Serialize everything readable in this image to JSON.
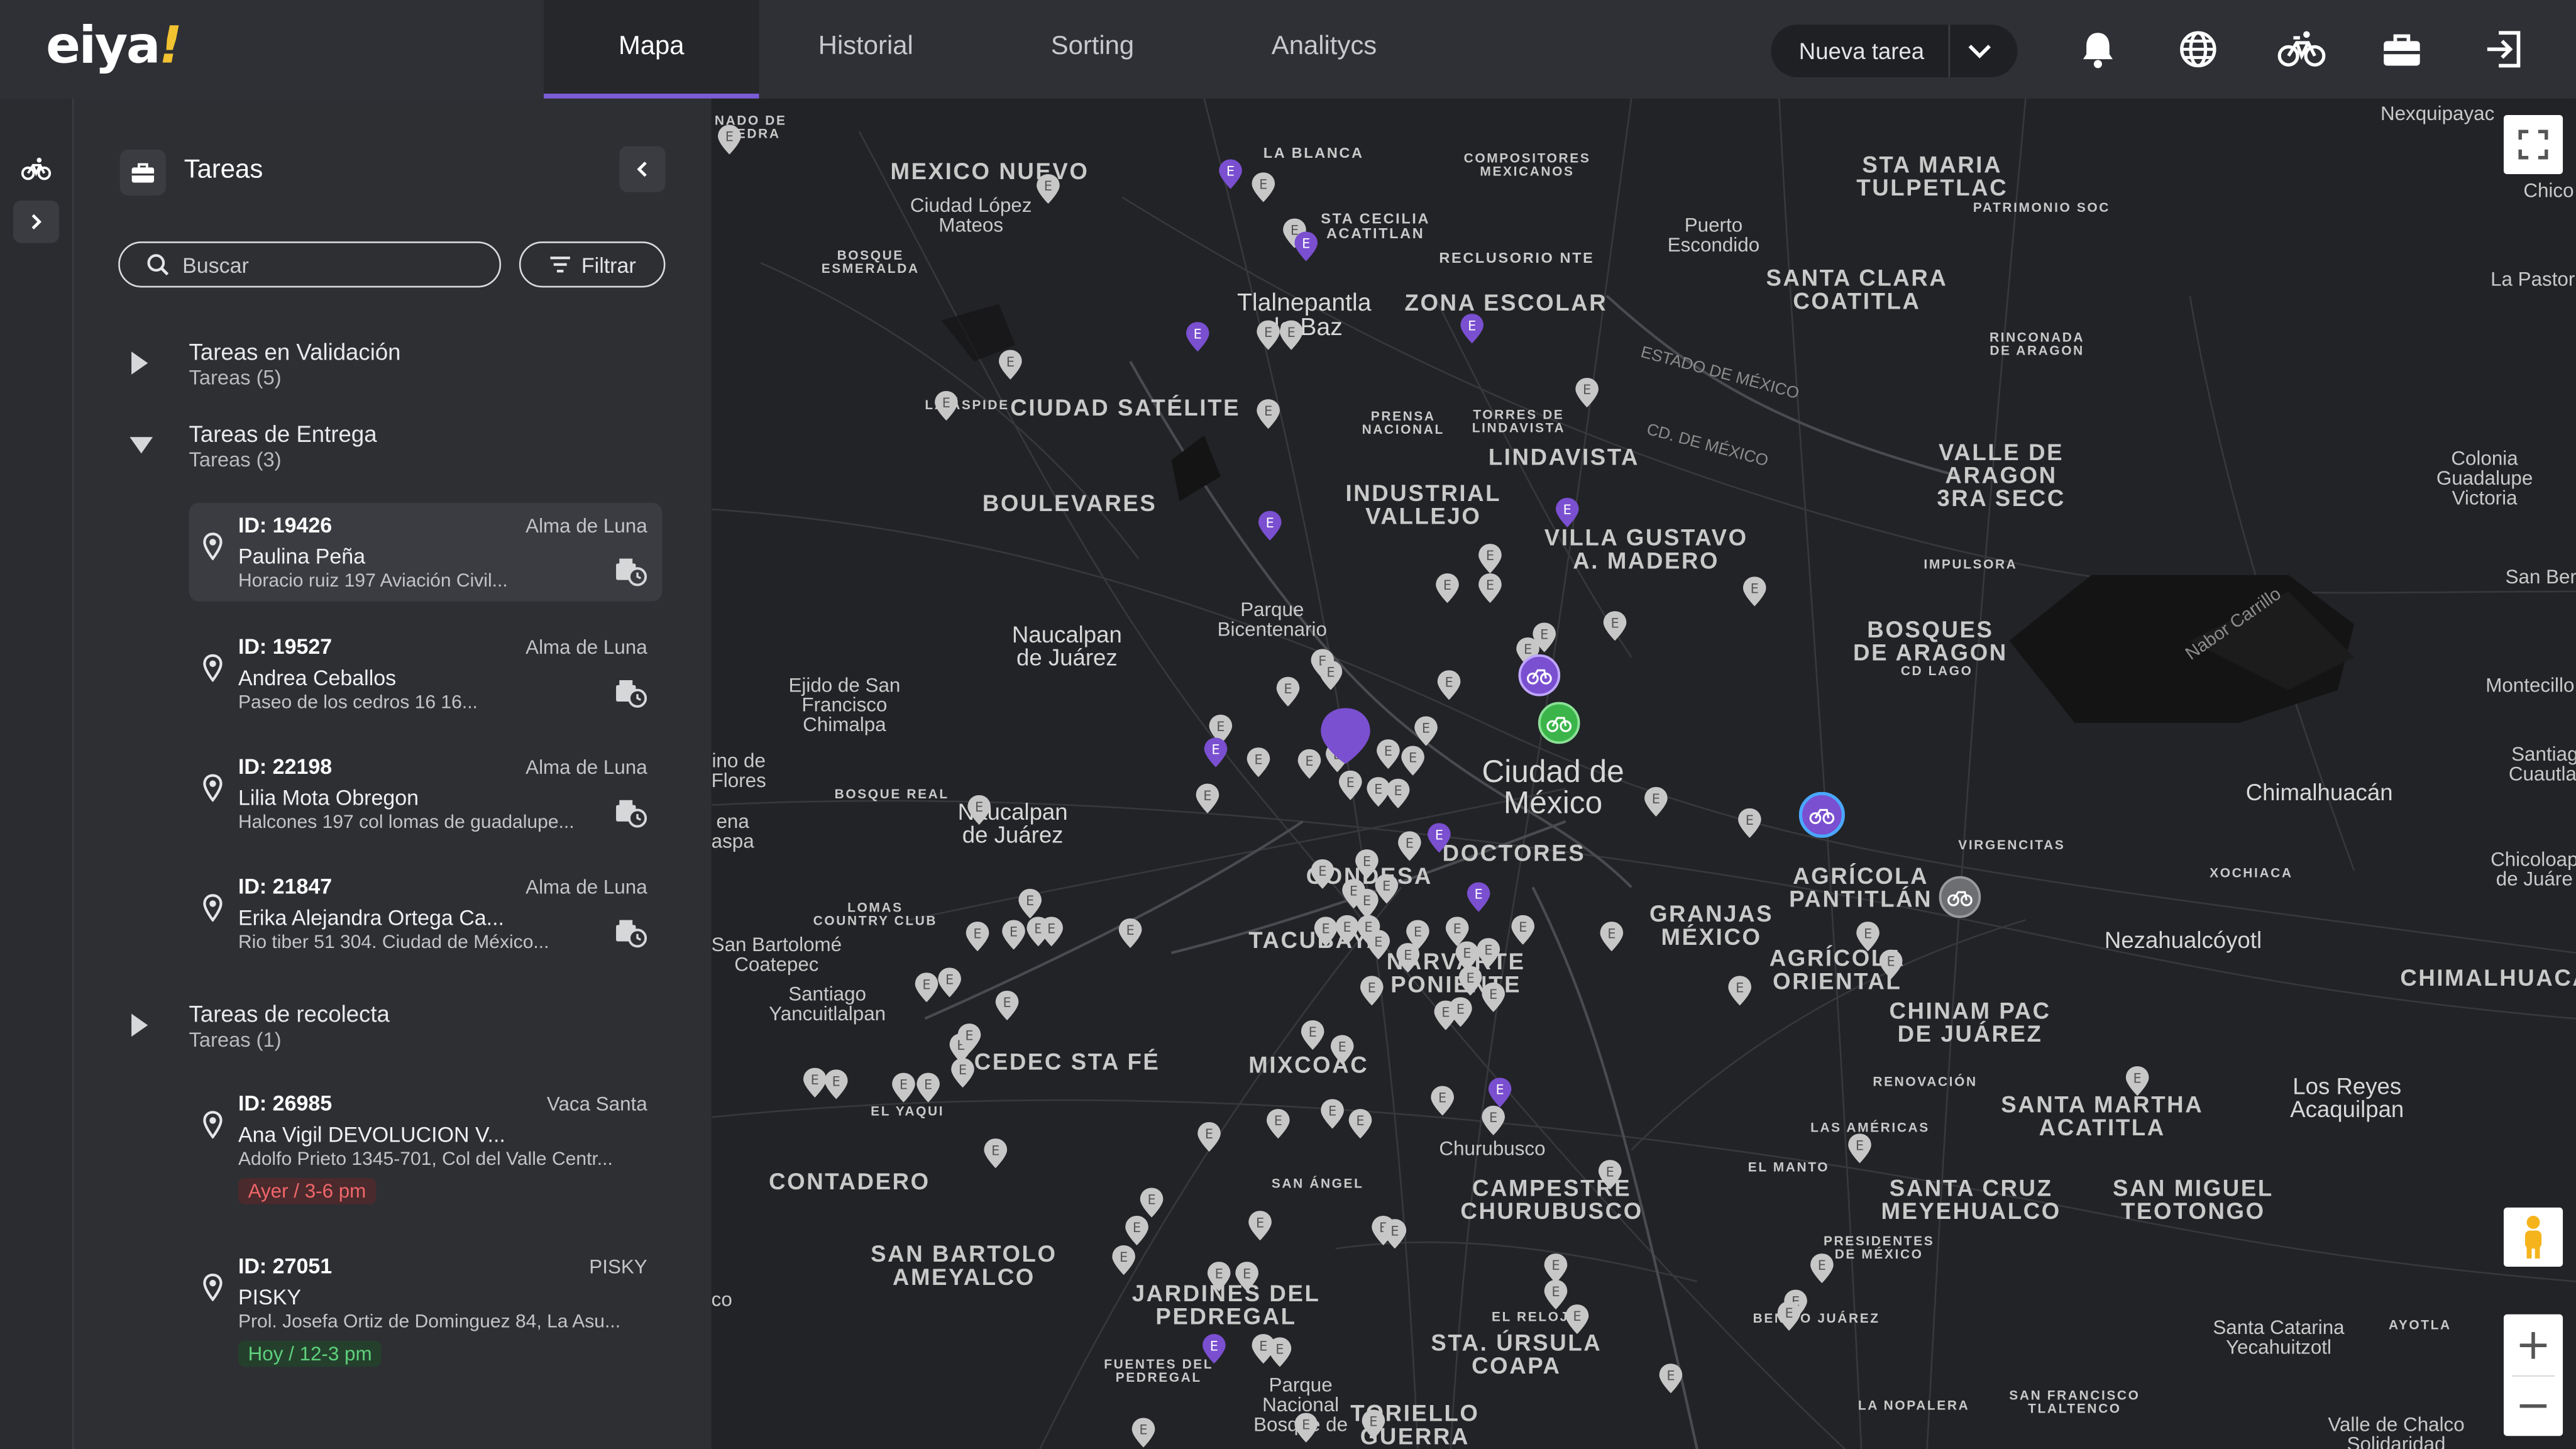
{
  "brand": {
    "logo_text": "eiya",
    "logo_accent": "!",
    "accent_color": "#f2c230",
    "tab_indicator_color": "#7b5cd6"
  },
  "nav": {
    "tabs": [
      {
        "label": "Mapa",
        "active": true
      },
      {
        "label": "Historial",
        "active": false
      },
      {
        "label": "Sorting",
        "active": false
      },
      {
        "label": "Analitycs",
        "active": false
      }
    ],
    "new_task_label": "Nueva tarea",
    "icons": [
      "bell-icon",
      "globe-icon",
      "bicycle-icon",
      "briefcase-icon",
      "logout-icon"
    ]
  },
  "panel": {
    "title": "Tareas",
    "search_placeholder": "Buscar",
    "filter_label": "Filtrar",
    "groups": [
      {
        "name": "Tareas en Validación",
        "count_label": "Tareas (5)",
        "expanded": false
      },
      {
        "name": "Tareas de Entrega",
        "count_label": "Tareas (3)",
        "expanded": true,
        "tasks": [
          {
            "id": "ID: 19426",
            "store": "Alma de Luna",
            "name": "Paulina Peña",
            "address": "Horacio ruiz 197 Aviación Civil...",
            "selected": true
          },
          {
            "id": "ID: 19527",
            "store": "Alma de Luna",
            "name": "Andrea Ceballos",
            "address": "Paseo de los cedros 16 16..."
          },
          {
            "id": "ID: 22198",
            "store": "Alma de Luna",
            "name": "Lilia Mota Obregon",
            "address": "Halcones 197 col lomas de guadalupe..."
          },
          {
            "id": "ID: 21847",
            "store": "Alma de Luna",
            "name": "Erika Alejandra Ortega Ca...",
            "address": "Rio tiber 51 304. Ciudad de México..."
          }
        ]
      },
      {
        "name": "Tareas de recolecta",
        "count_label": "Tareas (1)",
        "expanded": false,
        "tasks": [
          {
            "id": "ID: 26985",
            "store": "Vaca Santa",
            "name": "Ana Vigil DEVOLUCION V...",
            "address": "Adolfo Prieto 1345-701, Col del Valle Centr...",
            "badge": "Ayer / 3-6 pm",
            "badge_color": "#f0666a"
          },
          {
            "id": "ID: 27051",
            "store": "PISKY",
            "name": "PISKY",
            "address": "Prol. Josefa Ortiz de Dominguez 84, La Asu...",
            "badge": "Hoy / 12-3 pm",
            "badge_color": "#5fd07c"
          }
        ]
      }
    ]
  },
  "map": {
    "labels": {
      "mexico_nuevo": "MEXICO NUEVO",
      "ciudad_lopez_mateos": "Ciudad López\nMateos",
      "tlalnepantla": "Tlalnepantla\nde Baz",
      "zona_escolar": "ZONA ESCOLAR",
      "santa_clara": "SANTA CLARA\nCOATITLA",
      "sta_maria_tulpetlac": "STA MARIA\nTULPETLAC",
      "puerto_escondido": "Puerto\nEscondido",
      "ciudad_satelite": "CIUDAD SATÉLITE",
      "boulevares": "BOULEVARES",
      "industrial_vallejo": "INDUSTRIAL\nVALLEJO",
      "lindavista": "LINDAVISTA",
      "villa_gustavo": "VILLA GUSTAVO\nA. MADERO",
      "valle_de_aragon": "VALLE DE\nARAGON\n3RA SECC",
      "naucalpan_1": "Naucalpan\nde Juárez",
      "parque_bicentenario": "Parque\nBicentenario",
      "bosques_de_aragon": "BOSQUES\nDE ARAGON",
      "ciudad_de_mexico": "Ciudad de\nMéxico",
      "ejido_san_francisco": "Ejido de San\nFrancisco\nChimalpa",
      "naucalpan_2": "Naucalpan\nde Juárez",
      "doctores": "DOCTORES",
      "condesa": "CONDESA",
      "agricola_pantitlan": "AGRÍCOLA\nPANTITLÁN",
      "chimalhuacan": "Chimalhuacán",
      "granjas_mexico": "GRANJAS\nMÉXICO",
      "agricola_oriental": "AGRÍCOLA\nORIENTAL",
      "nezahualcoyotl": "Nezahualcóyotl",
      "chimalhuacan_caps": "CHIMALHUACAN",
      "chinam_pac": "CHINAM PAC\nDE JUÁREZ",
      "san_bartolome": "San Bartolomé\nCoatepec",
      "santiago_yancuitlalpan": "Santiago\nYancuitlalpan",
      "tacubaya": "TACUBAYA",
      "narvarte": "NARVARTE\nPONIENTE",
      "cedec_sta_fe": "CEDEC STA FÉ",
      "mixcoac": "MIXCOAC",
      "santa_martha": "SANTA MARTHA\nACATITLA",
      "los_reyes": "Los Reyes\nAcaquilpan",
      "contadero": "CONTADERO",
      "churubusco": "Churubusco",
      "campestre": "CAMPESTRE\nCHURUBUSCO",
      "santa_cruz": "SANTA CRUZ\nMEYEHUALCO",
      "san_miguel": "SAN MIGUEL\nTEOTONGO",
      "san_bartolo": "SAN BARTOLO\nAMEYALCO",
      "jardines_pedregal": "JARDINES DEL\nPEDREGAL",
      "sta_ursula": "STA. ÚRSULA\nCOAPA",
      "santa_catarina": "Santa Catarina\nYecahuitzotl",
      "toriello": "TORIELLO\nGUERRA",
      "parque_nacional": "Parque\nNacional\nBosque de",
      "valle_chalco": "Valle de Chalco\nSolidaridad",
      "colonia_guadalupe": "Colonia\nGuadalupe\nVictoria",
      "la_pastora": "La Pastor",
      "chico": "Chico",
      "san_ber": "San Ber",
      "montecillo": "Montecillo",
      "santiago_cuautlal": "Santiag\nCuautlal",
      "chicoloapan": "Chicoloap\nde Juáre",
      "nexquipayac": "Nexquipayac",
      "nabor_carrillo": "Nabor Carrillo",
      "la_blanca": "LA BLANCA",
      "sta_cecilia": "STA CECILIA\nACATITLAN",
      "compositores": "COMPOSITORES\nMEXICANOS",
      "reclusorio": "RECLUSORIO NTE",
      "patrimonio": "PATRIMONIO SOC",
      "rinconada": "RINCONADA\nDE ARAGON",
      "bosque_esmeralda": "BOSQUE\nESMERALDA",
      "prensa_nacional": "PRENSA\nNACIONAL",
      "torres_lindavista": "TORRES DE\nLINDAVISTA",
      "impulsora": "IMPULSORA",
      "cd_lago": "CD LAGO",
      "bosque_real": "BOSQUE REAL",
      "virgencitas": "VIRGENCITAS",
      "xochiaca": "XOCHIACA",
      "lomas_country": "LOMAS\nCOUNTRY CLUB",
      "el_yaqui": "EL YAQUI",
      "renovacion": "RENOVACIÓN",
      "las_americas": "LAS AMÉRICAS",
      "el_manto": "EL MANTO",
      "san_angel": "SAN ÁNGEL",
      "presidentes": "PRESIDENTES\nDE MÉXICO",
      "el_reloj": "EL RELOJ",
      "benito_juarez": "BENITO JUÁREZ",
      "ayotla": "AYOTLA",
      "fuentes_pedregal": "FUENTES DEL\nPEDREGAL",
      "la_nopalera": "LA NOPALERA",
      "san_francisco_tlaltenco": "SAN FRANCISCO\nTLALTENCO",
      "estado_de_mexico_road": "ESTADO DE MÉXICO",
      "cd_de_mexico_road": "CD. DE MÉXICO",
      "ino_de_flores": "ino de\nFlores",
      "ena_aspa": "ena\naspa",
      "nado_de_piedra": "NADO DE\nPIEDRA",
      "la_aspide": "LA ÁSPIDE",
      "co": "co"
    },
    "controls": {
      "fullscreen": "fullscreen-icon",
      "pegman": "pegman-icon",
      "zoom_in": "+",
      "zoom_out": "−"
    },
    "colors": {
      "pin_gray": "#c7c7c7",
      "pin_purple": "#7a4fd0",
      "rider_green": "#3bb54a"
    }
  }
}
